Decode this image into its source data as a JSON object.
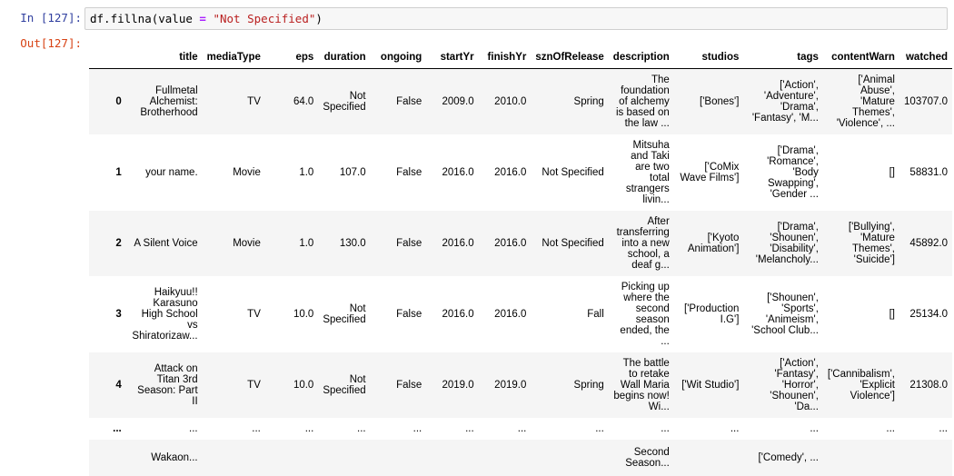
{
  "input": {
    "prompt": "In [127]:",
    "code_prefix": "df.fillna(value ",
    "code_op": "=",
    "code_space": " ",
    "code_string": "\"Not Specified\"",
    "code_suffix": ")"
  },
  "output": {
    "prompt": "Out[127]:"
  },
  "table": {
    "columns": [
      "",
      "title",
      "mediaType",
      "eps",
      "duration",
      "ongoing",
      "startYr",
      "finishYr",
      "sznOfRelease",
      "description",
      "studios",
      "tags",
      "contentWarn",
      "watched"
    ],
    "rows": [
      [
        "0",
        "Fullmetal Alchemist: Brotherhood",
        "TV",
        "64.0",
        "Not Specified",
        "False",
        "2009.0",
        "2010.0",
        "Spring",
        "The foundation of alchemy is based on the law ...",
        "['Bones']",
        "['Action', 'Adventure', 'Drama', 'Fantasy', 'M...",
        "['Animal Abuse', 'Mature Themes', 'Violence', ...",
        "103707.0"
      ],
      [
        "1",
        "your name.",
        "Movie",
        "1.0",
        "107.0",
        "False",
        "2016.0",
        "2016.0",
        "Not Specified",
        "Mitsuha and Taki are two total strangers livin...",
        "['CoMix Wave Films']",
        "['Drama', 'Romance', 'Body Swapping', 'Gender ...",
        "[]",
        "58831.0"
      ],
      [
        "2",
        "A Silent Voice",
        "Movie",
        "1.0",
        "130.0",
        "False",
        "2016.0",
        "2016.0",
        "Not Specified",
        "After transferring into a new school, a deaf g...",
        "['Kyoto Animation']",
        "['Drama', 'Shounen', 'Disability', 'Melancholy...",
        "['Bullying', 'Mature Themes', 'Suicide']",
        "45892.0"
      ],
      [
        "3",
        "Haikyuu!! Karasuno High School vs Shiratorizaw...",
        "TV",
        "10.0",
        "Not Specified",
        "False",
        "2016.0",
        "2016.0",
        "Fall",
        "Picking up where the second season ended, the ...",
        "['Production I.G']",
        "['Shounen', 'Sports', 'Animeism', 'School Club...",
        "[]",
        "25134.0"
      ],
      [
        "4",
        "Attack on Titan 3rd Season: Part II",
        "TV",
        "10.0",
        "Not Specified",
        "False",
        "2019.0",
        "2019.0",
        "Spring",
        "The battle to retake Wall Maria begins now! Wi...",
        "['Wit Studio']",
        "['Action', 'Fantasy', 'Horror', 'Shounen', 'Da...",
        "['Cannibalism', 'Explicit Violence']",
        "21308.0"
      ],
      [
        "...",
        "...",
        "...",
        "...",
        "...",
        "...",
        "...",
        "...",
        "...",
        "...",
        "...",
        "...",
        "...",
        "..."
      ],
      [
        "",
        "Wakaon...",
        "",
        "",
        "",
        "",
        "",
        "",
        "",
        "Second Season...",
        "",
        "['Comedy', ...",
        "",
        ""
      ]
    ]
  }
}
